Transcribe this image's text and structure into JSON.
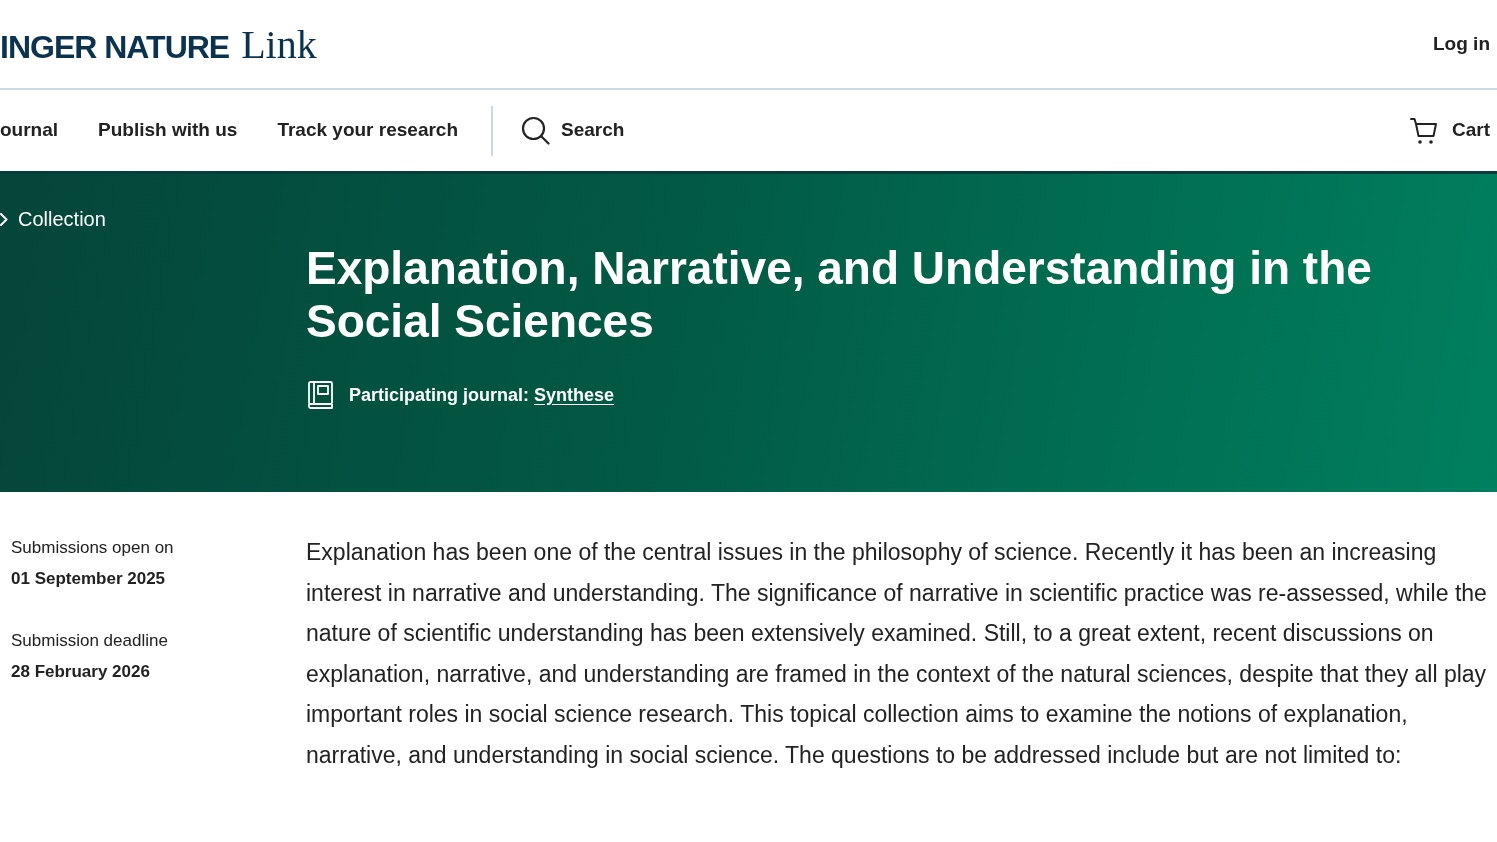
{
  "header": {
    "logo": {
      "brand": "INGER NATURE",
      "product": "Link"
    },
    "login": "Log in"
  },
  "nav": {
    "items": [
      "ournal",
      "Publish with us",
      "Track your research"
    ],
    "search": "Search",
    "cart": "Cart"
  },
  "banner": {
    "breadcrumb": "Collection",
    "title": "Explanation, Narrative, and Understanding in the Social Sciences",
    "journal": {
      "label": "Participating journal:",
      "link": "Synthese"
    }
  },
  "dates": [
    {
      "label": "Submissions open on",
      "value": "01 September 2025"
    },
    {
      "label": "Submission deadline",
      "value": "28 February 2026"
    }
  ],
  "description": "Explanation has been one of the central issues in the philosophy of science. Recently it has been an increasing interest in narrative and understanding. The significance of narrative in scientific practice was re-assessed, while the nature of scientific understanding has been extensively examined. Still, to a great extent, recent discussions on explanation, narrative, and understanding are framed in the context of the natural sciences, despite that they all play important roles in social science research. This topical collection aims to examine the notions of explanation, narrative, and understanding in social science. The questions to be addressed include but are not limited to:"
}
